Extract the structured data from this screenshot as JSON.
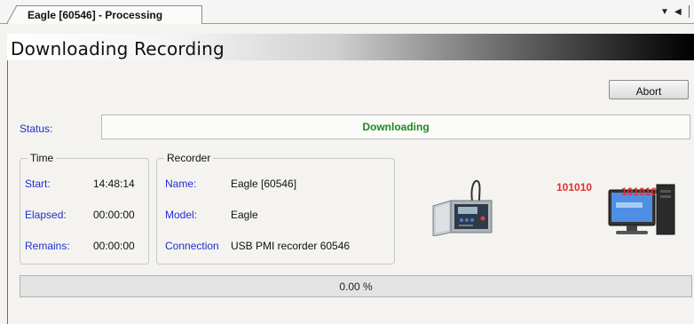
{
  "tab": {
    "title": "Eagle [60546]  - Processing"
  },
  "header": {
    "title": "Downloading Recording"
  },
  "actions": {
    "abort_label": "Abort"
  },
  "status": {
    "label": "Status:",
    "value": "Downloading"
  },
  "time_group": {
    "legend": "Time",
    "rows": [
      {
        "label": "Start:",
        "value": "14:48:14"
      },
      {
        "label": "Elapsed:",
        "value": "00:00:00"
      },
      {
        "label": "Remains:",
        "value": "00:00:00"
      }
    ]
  },
  "recorder_group": {
    "legend": "Recorder",
    "rows": [
      {
        "label": "Name:",
        "value": "Eagle [60546]"
      },
      {
        "label": "Model:",
        "value": "Eagle"
      },
      {
        "label": "Connection",
        "value": "USB PMI recorder 60546"
      }
    ]
  },
  "transfer": {
    "bits_left": "101010",
    "bits_right": "101010"
  },
  "progress": {
    "percent": 0,
    "text": "0.00 %"
  },
  "colors": {
    "label_blue": "#1f2fd0",
    "status_green": "#1c8a1c",
    "bits_red": "#e03030",
    "progress_fill": "#3a9d23"
  },
  "icons": [
    "dropdown-arrow-icon",
    "scroll-left-icon",
    "recorder-device-icon",
    "computer-monitor-icon"
  ]
}
